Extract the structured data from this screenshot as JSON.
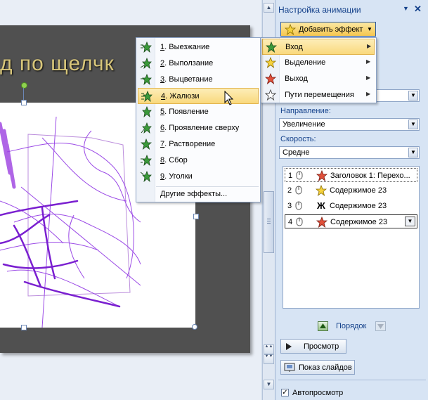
{
  "slide": {
    "title_fragment": "д по щелчк"
  },
  "scrollbar": {
    "up_arrow": "▲",
    "down_arrow": "▼",
    "page_up": "▲▲",
    "page_down": "▼▼"
  },
  "pane": {
    "title": "Настройка анимации",
    "add_effect_label": "Добавить эффект",
    "direction_label": "Направление:",
    "direction_value": "Увеличение",
    "speed_label": "Скорость:",
    "speed_value": "Средне",
    "top_combo_value": "",
    "animation_list": [
      {
        "num": "1",
        "text": "Заголовок 1: Перехо...",
        "icon": "star-red-icon"
      },
      {
        "num": "2",
        "text": "Содержимое 23",
        "icon": "star-yellow-icon"
      },
      {
        "num": "3",
        "text": "Содержимое 23",
        "icon": "bold-zh-icon",
        "glyph": "Ж"
      },
      {
        "num": "4",
        "text": "Содержимое 23",
        "icon": "star-red-icon"
      }
    ],
    "order_label": "Порядок",
    "preview_label": "Просмотр",
    "slideshow_label": "Показ слайдов",
    "autopreview_label": "Автопросмотр",
    "autopreview_checked": true
  },
  "effect_menu": {
    "items": [
      {
        "label": "Вход",
        "icon": "star-green-icon"
      },
      {
        "label": "Выделение",
        "icon": "star-yellow-icon"
      },
      {
        "label": "Выход",
        "icon": "star-red-icon"
      },
      {
        "label": "Пути перемещения",
        "icon": "star-outline-icon"
      }
    ],
    "highlighted": "Вход"
  },
  "entrance_submenu": {
    "items": [
      {
        "num": "1",
        "label": ". Выезжание"
      },
      {
        "num": "2",
        "label": ". Выползание"
      },
      {
        "num": "3",
        "label": ". Выцветание"
      },
      {
        "num": "4",
        "label": ". Жалюзи"
      },
      {
        "num": "5",
        "label": ". Появление"
      },
      {
        "num": "6",
        "label": ". Проявление сверху"
      },
      {
        "num": "7",
        "label": ". Растворение"
      },
      {
        "num": "8",
        "label": ". Сбор"
      },
      {
        "num": "9",
        "label": ". Уголки"
      }
    ],
    "other_effects": "Другие эффекты...",
    "highlighted": "4"
  },
  "colors": {
    "pane_bg": "#d7e4f4",
    "pane_text": "#15428b",
    "highlight": "#f9d97d",
    "slide_bg": "#505050",
    "title_gold": "#d8c67a",
    "scribble": "#8a2be2"
  }
}
